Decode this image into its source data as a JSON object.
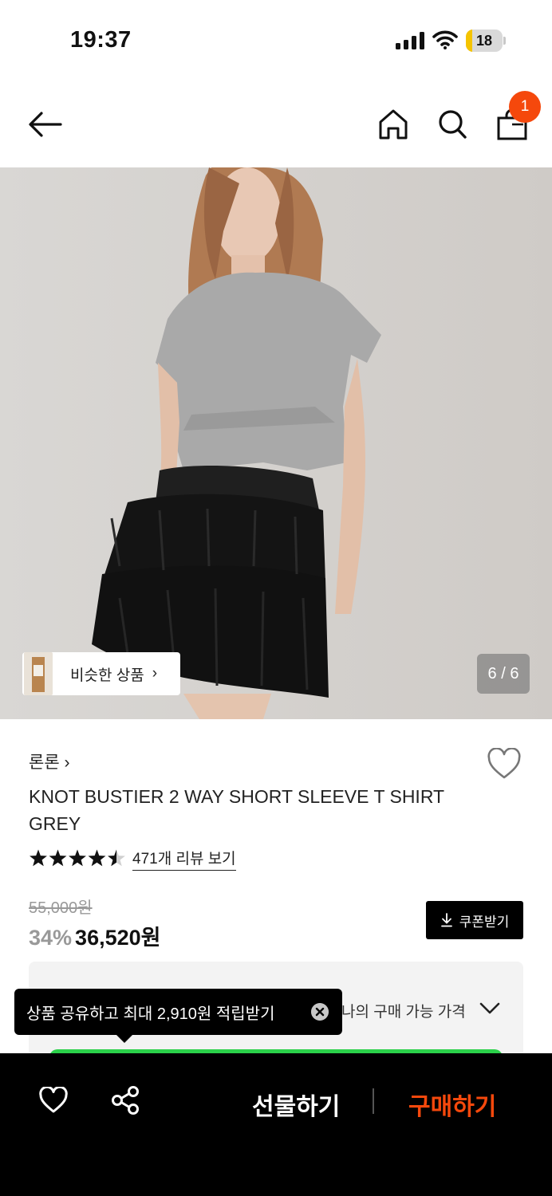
{
  "status_bar": {
    "time": "19:37",
    "battery_level": "18",
    "battery_fraction": 0.18,
    "battery_color": "#f5c400"
  },
  "header": {
    "back_icon": "arrow-left-icon",
    "home_icon": "home-icon",
    "search_icon": "search-icon",
    "bag_icon": "shopping-bag-icon",
    "cart_count": "1"
  },
  "gallery": {
    "similar_label": "비슷한 상품",
    "similar_chevron": "›",
    "page_counter": "6 / 6"
  },
  "product": {
    "brand": "론론 ›",
    "name": "KNOT BUSTIER 2 WAY SHORT SLEEVE T SHIRT GREY",
    "rating_value": 4.5,
    "review_link": "471개 리뷰 보기",
    "original_price": "55,000원",
    "discount_rate": "34%",
    "sale_price": "36,520원",
    "coupon_label": "쿠폰받기",
    "coupon_icon": "download-icon"
  },
  "my_price": {
    "label": "나의 구매 가능 가격",
    "chevron_icon": "chevron-down-icon"
  },
  "tooltip": {
    "text": "상품 공유하고 최대 2,910원 적립받기",
    "close_icon": "close-icon"
  },
  "bottom_bar": {
    "wish_icon": "heart-icon",
    "share_icon": "share-icon",
    "gift_label": "선물하기",
    "buy_label": "구매하기"
  },
  "colors": {
    "accent": "#f5480c",
    "green_bar": "#2bd14a",
    "bottom_bar_bg": "#000000"
  }
}
